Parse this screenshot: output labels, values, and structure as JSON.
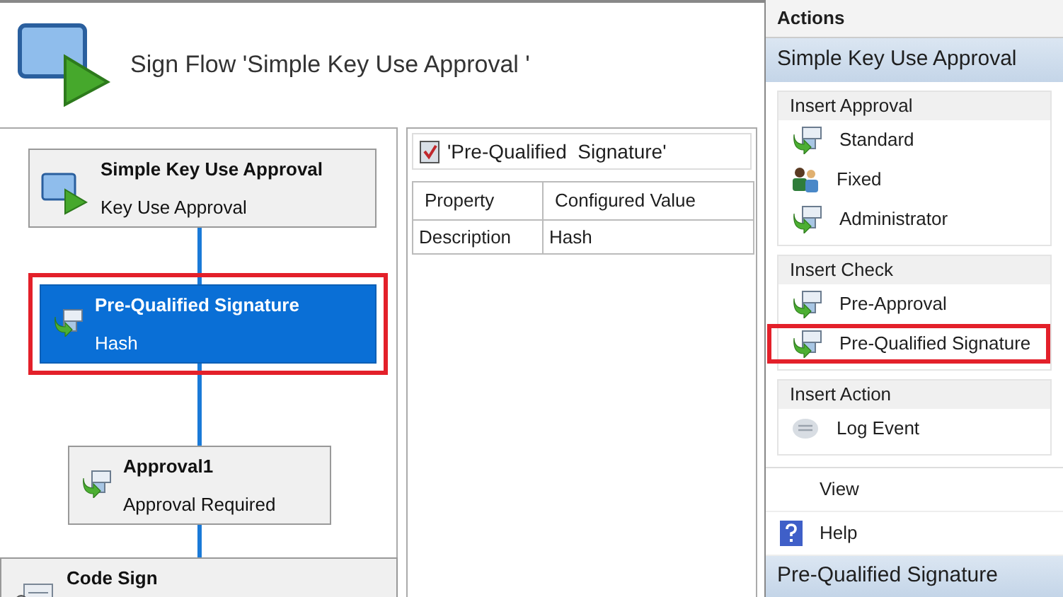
{
  "title": "Sign Flow 'Simple Key Use Approval '",
  "flow": {
    "nodes": [
      {
        "name": "Simple Key Use Approval",
        "subtitle": "Key Use Approval",
        "kind": "flow",
        "selected": false,
        "highlighted": false
      },
      {
        "name": "Pre-Qualified Signature",
        "subtitle": "Hash",
        "kind": "step",
        "selected": true,
        "highlighted": true
      },
      {
        "name": "Approval1",
        "subtitle": "Approval Required",
        "kind": "step",
        "selected": false,
        "highlighted": false
      },
      {
        "name": "Code Sign",
        "kind": "document",
        "selected": false,
        "highlighted": false
      }
    ]
  },
  "properties": {
    "title": "'Pre-Qualified  Signature'",
    "columns": [
      "Property",
      "Configured Value"
    ],
    "rows": [
      [
        "Description",
        "Hash"
      ]
    ]
  },
  "actions": {
    "title": "Actions",
    "header": "Simple Key Use Approval",
    "groups": [
      {
        "title": "Insert Approval",
        "items": [
          {
            "label": "Standard",
            "kind": "step",
            "highlighted": false
          },
          {
            "label": "Fixed",
            "kind": "users",
            "highlighted": false
          },
          {
            "label": "Administrator",
            "kind": "step",
            "highlighted": false
          }
        ]
      },
      {
        "title": "Insert Check",
        "items": [
          {
            "label": "Pre-Approval",
            "kind": "step",
            "highlighted": false
          },
          {
            "label": "Pre-Qualified Signature",
            "kind": "step",
            "highlighted": true
          }
        ]
      },
      {
        "title": "Insert Action",
        "items": [
          {
            "label": "Log Event",
            "kind": "log",
            "highlighted": false
          }
        ]
      }
    ],
    "links": [
      {
        "label": "View",
        "kind": "plain"
      },
      {
        "label": "Help",
        "kind": "help"
      }
    ],
    "footer": "Pre-Qualified Signature"
  }
}
